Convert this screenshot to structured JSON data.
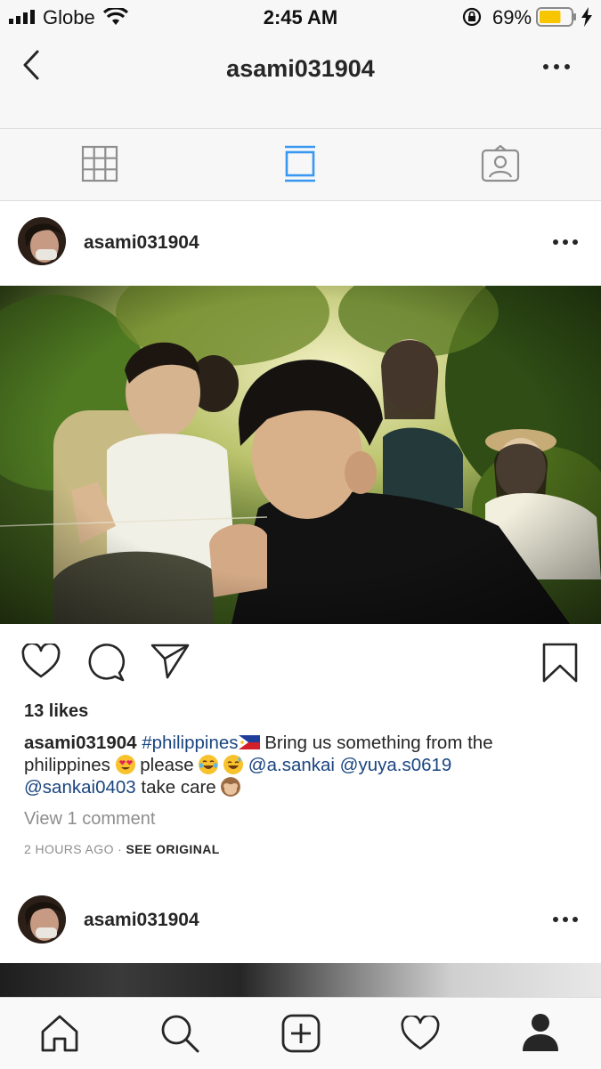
{
  "status_bar": {
    "carrier": "Globe",
    "time": "2:45 AM",
    "battery_percent": "69%",
    "battery_level": 0.69
  },
  "header": {
    "title": "asami031904"
  },
  "posts": [
    {
      "username": "asami031904",
      "likes": "13 likes",
      "caption": {
        "username": "asami031904",
        "hashtag": "#philippines",
        "text1": " Bring us something from the philippines ",
        "text2": " please ",
        "mention1": "@a.sankai",
        "mention2": "@yuya.s0619",
        "mention3": "@sankai0403",
        "text3": " take care "
      },
      "view_comments": "View 1 comment",
      "timestamp": "2 HOURS AGO",
      "separator": " · ",
      "see_original": "SEE ORIGINAL"
    },
    {
      "username": "asami031904"
    }
  ],
  "icons": {
    "tabs": [
      "grid-icon",
      "feed-icon",
      "tagged-icon"
    ],
    "actions": [
      "heart-icon",
      "comment-icon",
      "share-icon",
      "bookmark-icon"
    ],
    "nav": [
      "home-icon",
      "search-icon",
      "add-icon",
      "activity-icon",
      "profile-icon"
    ]
  },
  "colors": {
    "active_tab": "#3897f0",
    "link": "#1a4580",
    "battery": "#f7c600"
  }
}
